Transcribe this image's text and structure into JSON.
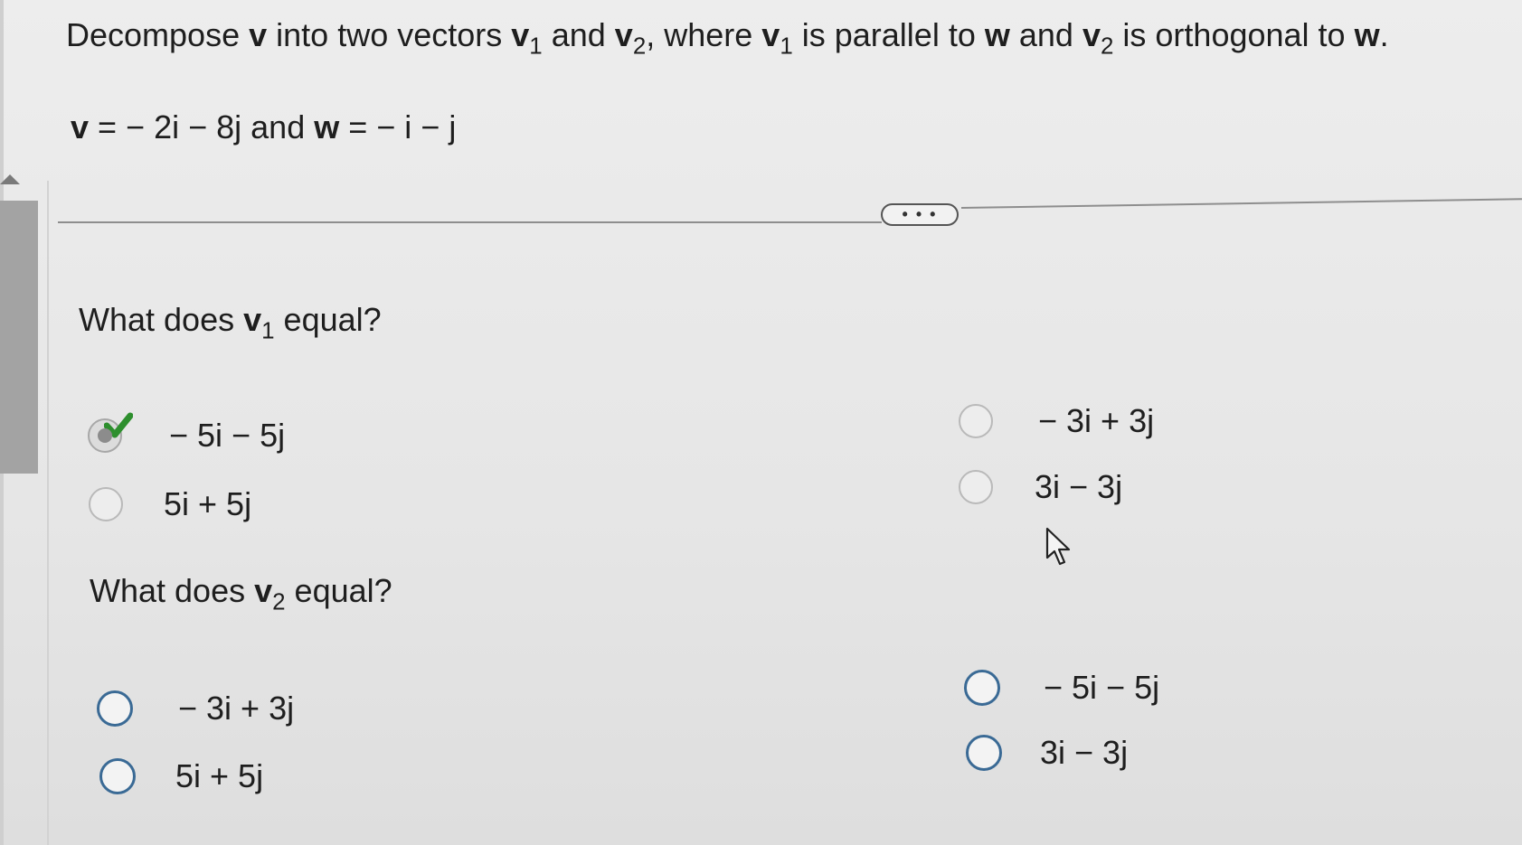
{
  "prompt": {
    "p1": "Decompose ",
    "v": "v",
    "p2": " into two vectors ",
    "v1a": "v",
    "v1a_sub": "1",
    "p3": " and ",
    "v2a": "v",
    "v2a_sub": "2",
    "p4": ", where ",
    "v1b": "v",
    "v1b_sub": "1",
    "p5": " is parallel to ",
    "w1": "w",
    "p6": " and ",
    "v2b": "v",
    "v2b_sub": "2",
    "p7": " is orthogonal to ",
    "w2": "w",
    "p8": "."
  },
  "given": {
    "v_sym": "v",
    "v_expr": " = − 2i − 8j and ",
    "w_sym": "w",
    "w_expr": " = − i − j"
  },
  "expand_button_label": "• • •",
  "question1": {
    "pre": "What does ",
    "var": "v",
    "sub": "1",
    "post": " equal?",
    "options": [
      {
        "label": "− 5i − 5j",
        "selected": true,
        "correct": true
      },
      {
        "label": "5i + 5j",
        "selected": false
      },
      {
        "label": "− 3i + 3j",
        "selected": false
      },
      {
        "label": "3i − 3j",
        "selected": false
      }
    ]
  },
  "question2": {
    "pre": "What does ",
    "var": "v",
    "sub": "2",
    "post": " equal?",
    "options": [
      {
        "label": "− 3i + 3j",
        "selected": false
      },
      {
        "label": "5i + 5j",
        "selected": false
      },
      {
        "label": "− 5i − 5j",
        "selected": false
      },
      {
        "label": "3i − 3j",
        "selected": false
      }
    ]
  },
  "colors": {
    "check": "#2e8f2e",
    "radio_border_active": "#3a6a95",
    "text": "#1e1e1e"
  },
  "icons": {
    "check": "check-icon",
    "cursor": "cursor-arrow-icon",
    "scroll": "scroll-up-arrow-icon"
  }
}
